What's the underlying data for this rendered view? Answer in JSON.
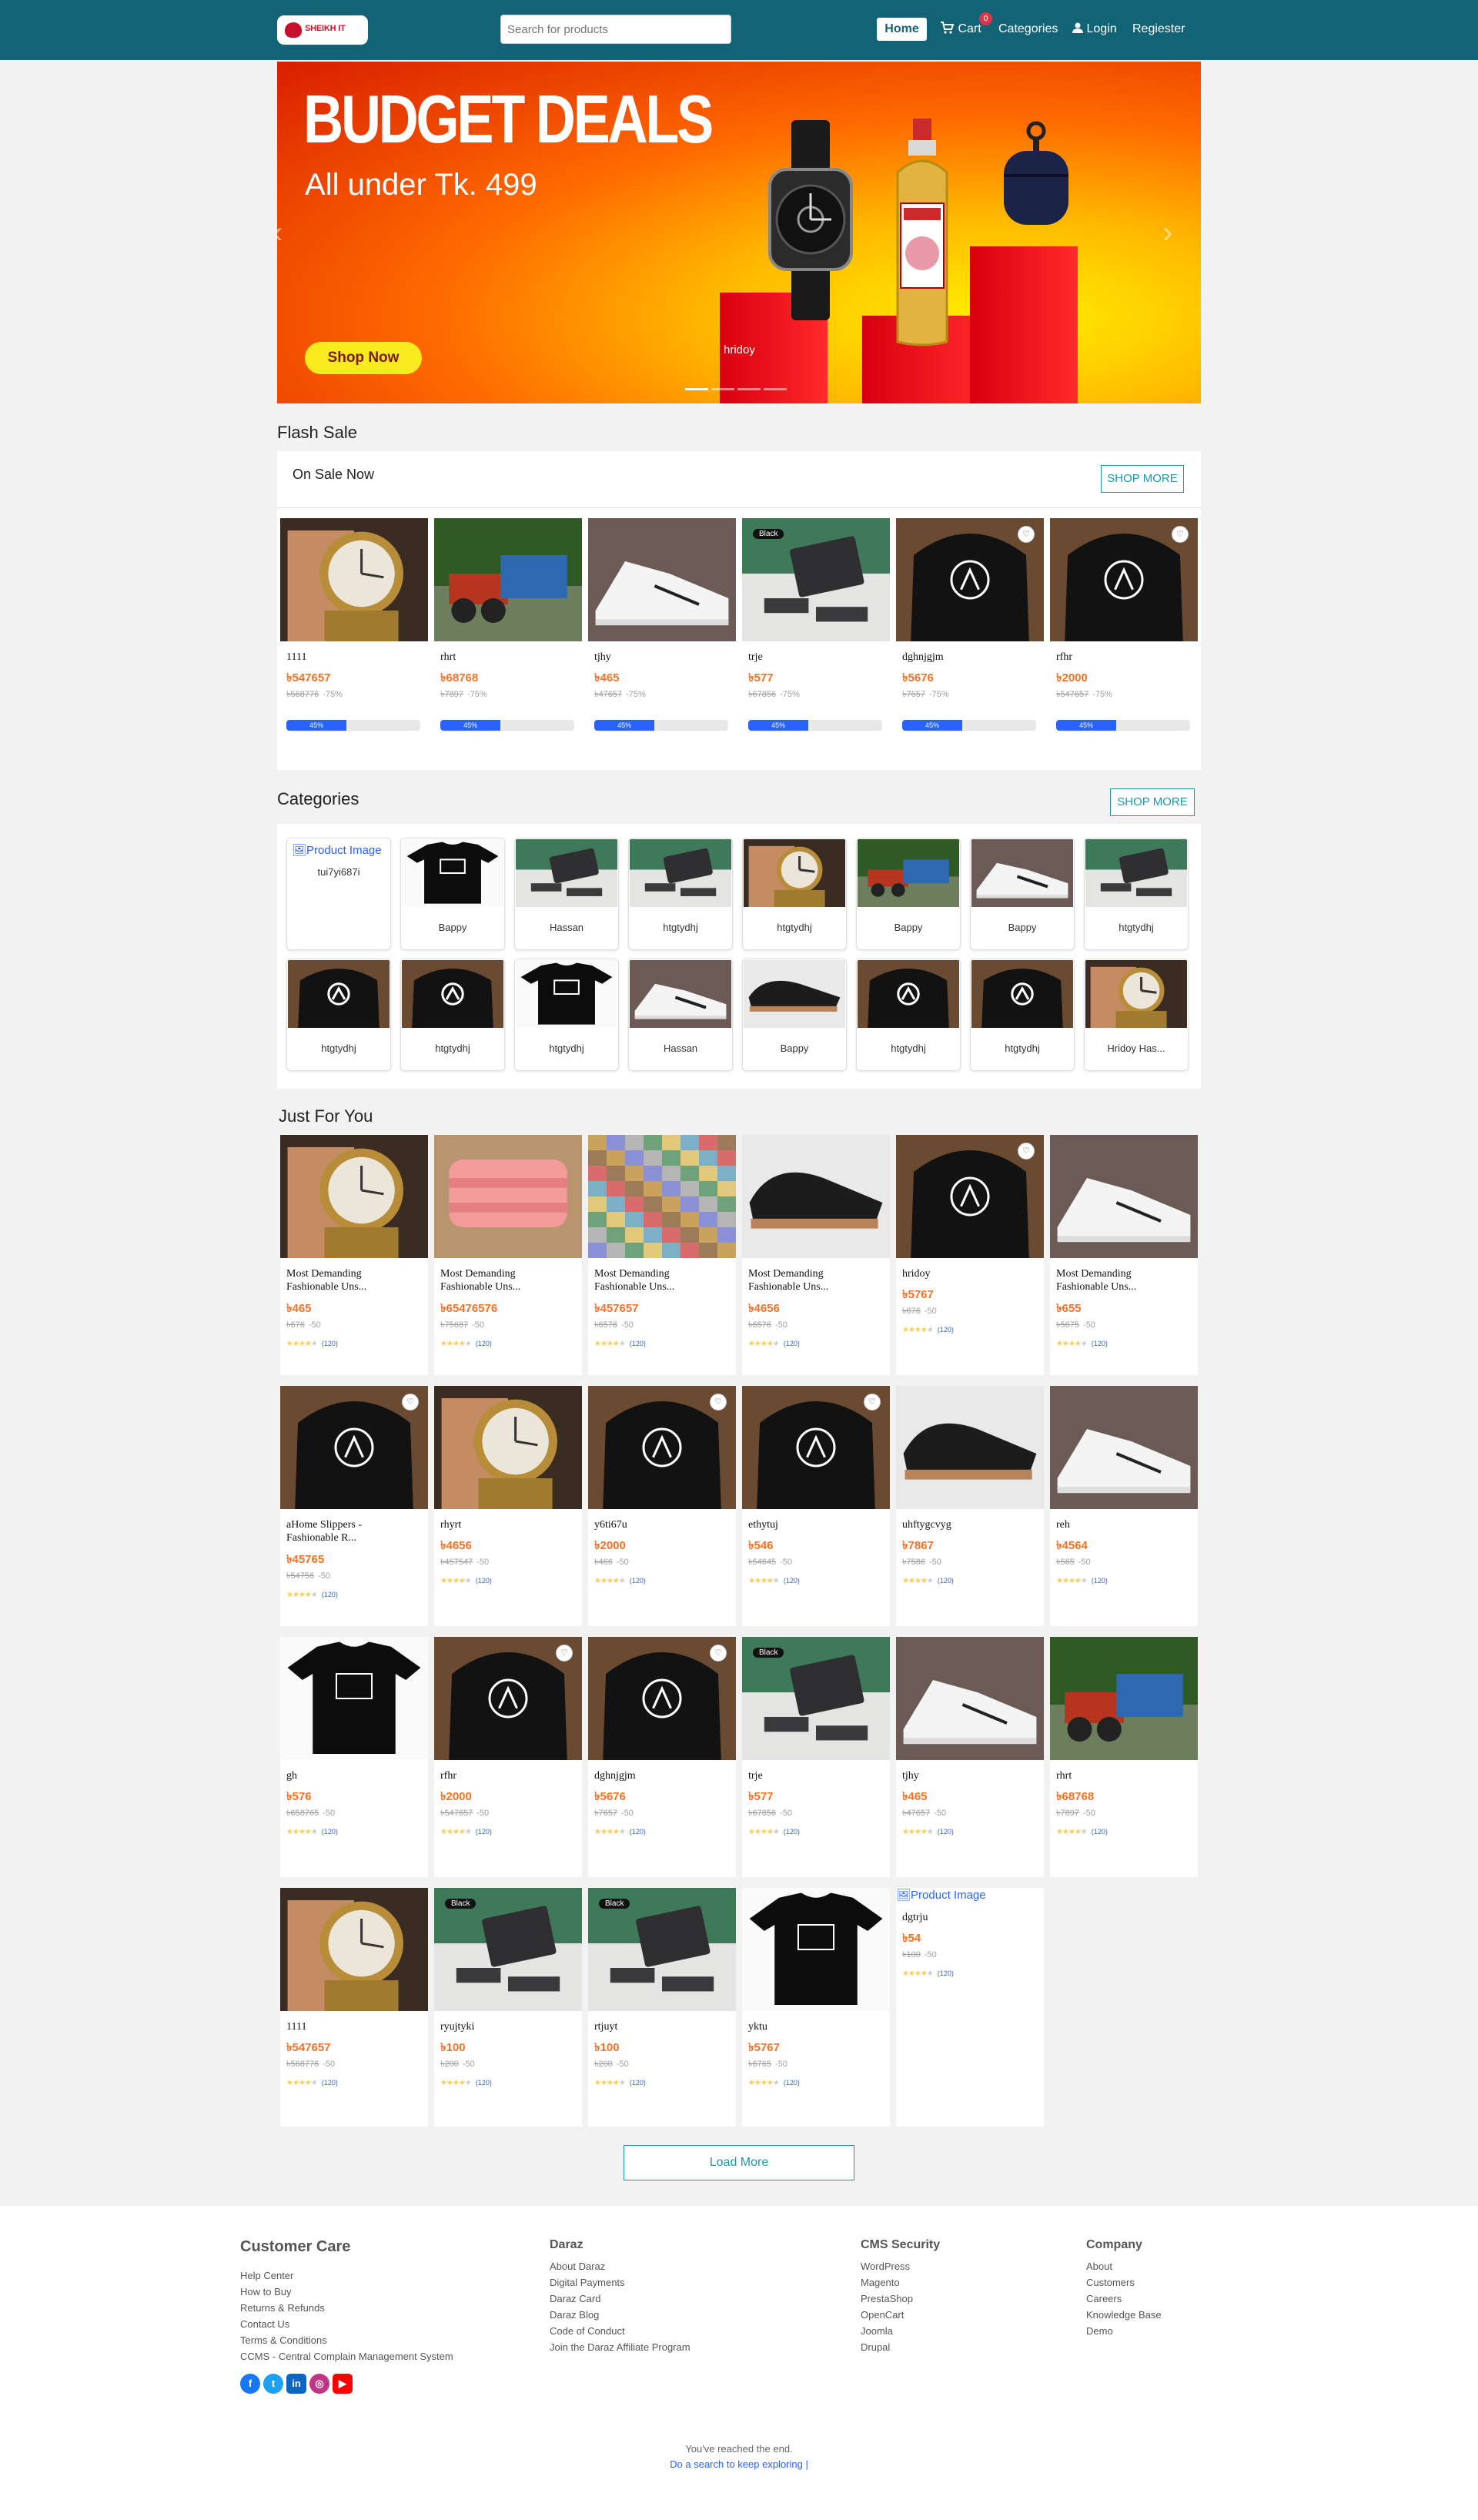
{
  "navbar": {
    "logo_text": "SHEIKH IT",
    "search_placeholder": "Search for products",
    "home_label": "Home",
    "cart_label": "Cart",
    "cart_count": "0",
    "categories_label": "Categories",
    "login_label": "Login",
    "register_label": "Regiester"
  },
  "banner": {
    "title": "BUDGET DEALS",
    "subtitle": "All under Tk. 499",
    "cta": "Shop Now",
    "caption": "hridoy"
  },
  "flash_sale": {
    "title": "Flash Sale",
    "subtitle": "On Sale Now",
    "shop_more": "SHOP MORE",
    "products": [
      {
        "name": "1111",
        "price": "৳547657",
        "old": "৳568776",
        "disc": "-75%",
        "img": "watch",
        "progress": 45,
        "progress_label": "45%"
      },
      {
        "name": "rhrt",
        "price": "৳68768",
        "old": "৳7897",
        "disc": "-75%",
        "img": "tractor",
        "progress": 45,
        "progress_label": "45%"
      },
      {
        "name": "tjhy",
        "price": "৳465",
        "old": "৳47657",
        "disc": "-75%",
        "img": "sneaker",
        "progress": 45,
        "progress_label": "45%"
      },
      {
        "name": "trje",
        "price": "৳577",
        "old": "৳67856",
        "disc": "-75%",
        "img": "stand",
        "progress": 45,
        "progress_label": "45%"
      },
      {
        "name": "dghnjgjm",
        "price": "৳5676",
        "old": "৳7657",
        "disc": "-75%",
        "img": "hoodie",
        "progress": 45,
        "progress_label": "45%"
      },
      {
        "name": "rfhr",
        "price": "৳2000",
        "old": "৳547657",
        "disc": "-75%",
        "img": "hoodie",
        "progress": 45,
        "progress_label": "45%"
      }
    ]
  },
  "categories": {
    "title": "Categories",
    "shop_more": "SHOP MORE",
    "broken_image_text": "Product Image",
    "items": [
      {
        "name": "tui7yi687i",
        "img": "broken"
      },
      {
        "name": "Bappy",
        "img": "tshirt"
      },
      {
        "name": "Hassan",
        "img": "stand"
      },
      {
        "name": "htgtydhj",
        "img": "stand"
      },
      {
        "name": "htgtydhj",
        "img": "watch"
      },
      {
        "name": "Bappy",
        "img": "tractor"
      },
      {
        "name": "Bappy",
        "img": "sneaker"
      },
      {
        "name": "htgtydhj",
        "img": "stand"
      },
      {
        "name": "htgtydhj",
        "img": "hoodie"
      },
      {
        "name": "htgtydhj",
        "img": "hoodie"
      },
      {
        "name": "htgtydhj",
        "img": "tshirt"
      },
      {
        "name": "Hassan",
        "img": "sneaker"
      },
      {
        "name": "Bappy",
        "img": "loafer"
      },
      {
        "name": "htgtydhj",
        "img": "hoodie"
      },
      {
        "name": "htgtydhj",
        "img": "hoodie"
      },
      {
        "name": "Hridoy Has...",
        "img": "watch"
      }
    ]
  },
  "just_for_you": {
    "title": "Just For You",
    "rating_count": "(120)",
    "load_more": "Load More",
    "broken_image_text": "Product Image",
    "products": [
      {
        "name": "Most Demanding Fashionable Uns...",
        "price": "৳465",
        "old": "৳676",
        "disc": "-50",
        "img": "watch",
        "rating": 4
      },
      {
        "name": "Most Demanding Fashionable Uns...",
        "price": "৳65476576",
        "old": "৳75687",
        "disc": "-50",
        "img": "blanket",
        "rating": 4
      },
      {
        "name": "Most Demanding Fashionable Uns...",
        "price": "৳457657",
        "old": "৳6576",
        "disc": "-50",
        "img": "mosaic",
        "rating": 4
      },
      {
        "name": "Most Demanding Fashionable Uns...",
        "price": "৳4656",
        "old": "৳6576",
        "disc": "-50",
        "img": "loafer",
        "rating": 4
      },
      {
        "name": "hridoy",
        "price": "৳5767",
        "old": "৳676",
        "disc": "-50",
        "img": "hoodie",
        "rating": 4
      },
      {
        "name": "Most Demanding Fashionable Uns...",
        "price": "৳655",
        "old": "৳5675",
        "disc": "-50",
        "img": "sneaker",
        "rating": 4
      },
      {
        "name": "aHome Slippers - Fashionable R...",
        "price": "৳45765",
        "old": "৳54756",
        "disc": "-50",
        "img": "hoodie",
        "rating": 4
      },
      {
        "name": "rhyrt",
        "price": "৳4656",
        "old": "৳457547",
        "disc": "-50",
        "img": "watch",
        "rating": 4
      },
      {
        "name": "y6ti67u",
        "price": "৳2000",
        "old": "৳466",
        "disc": "-50",
        "img": "hoodie",
        "rating": 4
      },
      {
        "name": "ethytuj",
        "price": "৳546",
        "old": "৳54645",
        "disc": "-50",
        "img": "hoodie",
        "rating": 4
      },
      {
        "name": "uhftygcvyg",
        "price": "৳7867",
        "old": "৳7586",
        "disc": "-50",
        "img": "loafer",
        "rating": 4
      },
      {
        "name": "reh",
        "price": "৳4564",
        "old": "৳565",
        "disc": "-50",
        "img": "sneaker",
        "rating": 4
      },
      {
        "name": "gh",
        "price": "৳576",
        "old": "৳658765",
        "disc": "-50",
        "img": "tshirt",
        "rating": 4
      },
      {
        "name": "rfhr",
        "price": "৳2000",
        "old": "৳547657",
        "disc": "-50",
        "img": "hoodie",
        "rating": 4
      },
      {
        "name": "dghnjgjm",
        "price": "৳5676",
        "old": "৳7657",
        "disc": "-50",
        "img": "hoodie",
        "rating": 4
      },
      {
        "name": "trje",
        "price": "৳577",
        "old": "৳67856",
        "disc": "-50",
        "img": "stand",
        "rating": 4
      },
      {
        "name": "tjhy",
        "price": "৳465",
        "old": "৳47657",
        "disc": "-50",
        "img": "sneaker",
        "rating": 4
      },
      {
        "name": "rhrt",
        "price": "৳68768",
        "old": "৳7897",
        "disc": "-50",
        "img": "tractor",
        "rating": 4
      },
      {
        "name": "1111",
        "price": "৳547657",
        "old": "৳568776",
        "disc": "-50",
        "img": "watch",
        "rating": 4
      },
      {
        "name": "ryujtyki",
        "price": "৳100",
        "old": "৳200",
        "disc": "-50",
        "img": "stand",
        "rating": 4
      },
      {
        "name": "rtjuyt",
        "price": "৳100",
        "old": "৳200",
        "disc": "-50",
        "img": "stand",
        "rating": 4
      },
      {
        "name": "yktu",
        "price": "৳5767",
        "old": "৳6765",
        "disc": "-50",
        "img": "tshirt",
        "rating": 4
      },
      {
        "name": "dgtrju",
        "price": "৳54",
        "old": "৳100",
        "disc": "-50",
        "img": "broken",
        "rating": 4
      }
    ]
  },
  "footer": {
    "customer_care": {
      "title": "Customer Care",
      "links": [
        "Help Center",
        "How to Buy",
        "Returns & Refunds",
        "Contact Us",
        "Terms & Conditions",
        "CCMS - Central Complain Management System"
      ]
    },
    "daraz": {
      "title": "Daraz",
      "links": [
        "About Daraz",
        "Digital Payments",
        "Daraz Card",
        "Daraz Blog",
        "Code of Conduct",
        "Join the Daraz Affiliate Program"
      ]
    },
    "cms": {
      "title": "CMS Security",
      "links": [
        "WordPress",
        "Magento",
        "PrestaShop",
        "OpenCart",
        "Joomla",
        "Drupal"
      ]
    },
    "company": {
      "title": "Company",
      "links": [
        "About",
        "Customers",
        "Careers",
        "Knowledge Base",
        "Demo"
      ]
    },
    "social_icons": [
      "facebook-icon",
      "twitter-icon",
      "linkedin-icon",
      "instagram-icon",
      "youtube-icon"
    ],
    "end_text": "You've reached the end.",
    "end_link": "Do a search to keep exploring |"
  },
  "colors": {
    "nav": "#136377",
    "price": "#f57224",
    "accent": "#1e97a8",
    "progress": "#2962ff"
  }
}
